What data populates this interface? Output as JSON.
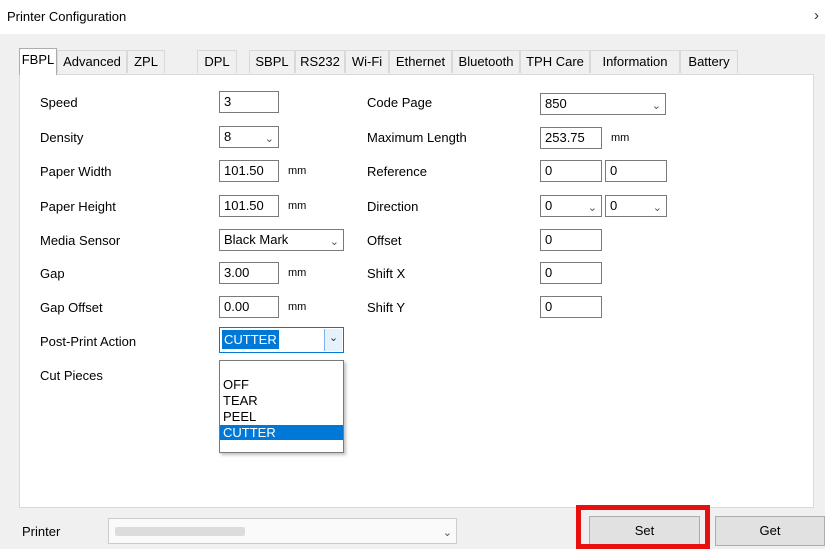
{
  "window": {
    "title": "Printer Configuration",
    "close_glyph": "›"
  },
  "tabs": [
    "FBPL",
    "Advanced",
    "ZPL",
    "DPL",
    "SBPL",
    "RS232",
    "Wi-Fi",
    "Ethernet",
    "Bluetooth",
    "TPH Care",
    "Information",
    "Battery"
  ],
  "active_tab": "FBPL",
  "left": {
    "speed_label": "Speed",
    "speed_value": "3",
    "density_label": "Density",
    "density_value": "8",
    "paper_width_label": "Paper Width",
    "paper_width_value": "101.50",
    "paper_width_unit": "mm",
    "paper_height_label": "Paper Height",
    "paper_height_value": "101.50",
    "paper_height_unit": "mm",
    "media_sensor_label": "Media Sensor",
    "media_sensor_value": "Black Mark",
    "gap_label": "Gap",
    "gap_value": "3.00",
    "gap_unit": "mm",
    "gap_offset_label": "Gap Offset",
    "gap_offset_value": "0.00",
    "gap_offset_unit": "mm",
    "post_print_label": "Post-Print Action",
    "post_print_value": "CUTTER",
    "cut_pieces_label": "Cut Pieces"
  },
  "dropdown_options": [
    "OFF",
    "TEAR",
    "PEEL",
    "CUTTER"
  ],
  "dropdown_selected": "CUTTER",
  "right": {
    "code_page_label": "Code Page",
    "code_page_value": "850",
    "max_length_label": "Maximum Length",
    "max_length_value": "253.75",
    "max_length_unit": "mm",
    "reference_label": "Reference",
    "reference_x": "0",
    "reference_y": "0",
    "direction_label": "Direction",
    "direction_a": "0",
    "direction_b": "0",
    "offset_label": "Offset",
    "offset_value": "0",
    "shift_x_label": "Shift X",
    "shift_x_value": "0",
    "shift_y_label": "Shift Y",
    "shift_y_value": "0"
  },
  "bottom": {
    "printer_label": "Printer",
    "set_label": "Set",
    "get_label": "Get"
  },
  "colors": {
    "highlight": "#e8100e",
    "selection": "#0078d7"
  },
  "icons": {
    "dropdown": "chevron-down-icon",
    "close": "close-icon"
  }
}
